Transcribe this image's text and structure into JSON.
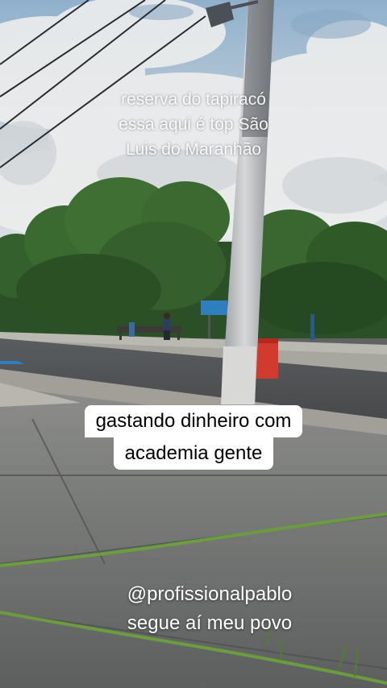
{
  "captions": {
    "top_lines": [
      "reserva do tapiracó",
      "essa aqui é top São",
      "Luis do Maranhão"
    ],
    "middle_lines": [
      "gastando dinheiro com",
      "academia gente"
    ],
    "bottom_lines": [
      "@profissionalpablo",
      "segue aí meu povo"
    ]
  },
  "scene": {
    "subjects": [
      "sky-with-clouds",
      "power-lines",
      "concrete-utility-pole",
      "trees",
      "road",
      "blue-sign",
      "red-trash-bin",
      "bench",
      "person-at-bench",
      "sidewalk",
      "grass-strips"
    ],
    "colors": {
      "sky": "#9fb6c9",
      "clouds": "#e8e9ea",
      "trees": "#2f5a2a",
      "road": "#4d5052",
      "sidewalk": "#7d7f7e",
      "pole": "#c7cacb",
      "bin": "#d13a2c",
      "sign": "#2f7fbf",
      "grass": "#6ba33a"
    }
  }
}
